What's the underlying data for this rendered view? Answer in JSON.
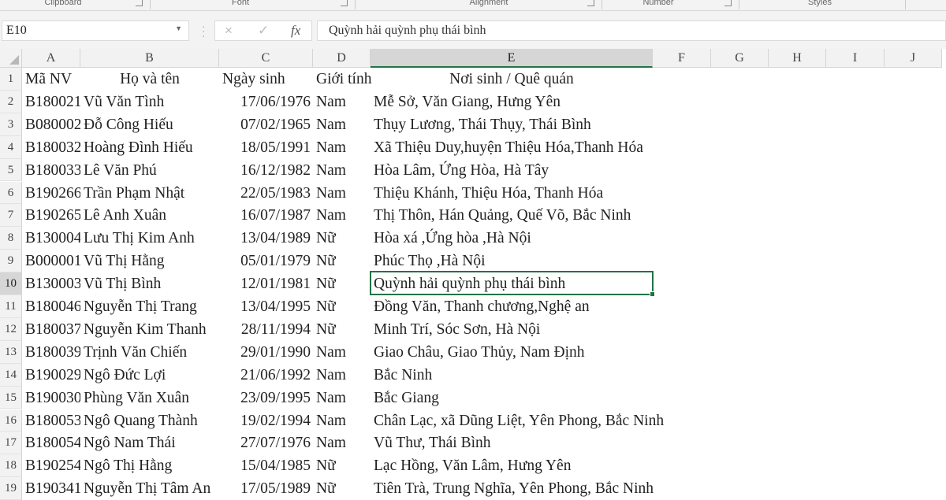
{
  "ribbon": {
    "groups": [
      "Clipboard",
      "Font",
      "Alignment",
      "Number",
      "Styles"
    ]
  },
  "formula_bar": {
    "name_box": "E10",
    "cancel_icon": "×",
    "enter_icon": "✓",
    "fx_label": "fx",
    "value": "Quỳnh hải quỳnh phụ thái bình"
  },
  "columns": [
    "A",
    "B",
    "C",
    "D",
    "E",
    "F",
    "G",
    "H",
    "I",
    "J"
  ],
  "selected_cell": "E10",
  "header_row": [
    "Mã NV",
    "Họ và tên",
    "Ngày sinh",
    "Giới tính",
    "Nơi sinh / Quê quán"
  ],
  "rows": [
    [
      "B180021",
      "Vũ Văn Tình",
      "17/06/1976",
      "Nam",
      "Mễ Sở, Văn Giang, Hưng Yên"
    ],
    [
      "B080002",
      "Đỗ Công Hiếu",
      "07/02/1965",
      "Nam",
      "Thụy Lương, Thái Thụy, Thái Bình"
    ],
    [
      "B180032",
      "Hoàng Đình Hiếu",
      "18/05/1991",
      "Nam",
      "Xã Thiệu Duy,huyện Thiệu Hóa,Thanh Hóa"
    ],
    [
      "B180033",
      "Lê Văn Phú",
      "16/12/1982",
      "Nam",
      "Hòa Lâm, Ứng Hòa, Hà Tây"
    ],
    [
      "B190266",
      "Trần Phạm Nhật",
      "22/05/1983",
      "Nam",
      "Thiệu Khánh, Thiệu Hóa, Thanh Hóa"
    ],
    [
      "B190265",
      "Lê Anh Xuân",
      "16/07/1987",
      "Nam",
      "Thị Thôn, Hán Quảng, Quế Võ, Bắc Ninh"
    ],
    [
      "B130004",
      "Lưu Thị Kim Anh",
      "13/04/1989",
      "Nữ",
      "Hòa xá ,Ứng hòa ,Hà Nội"
    ],
    [
      "B000001",
      "Vũ Thị Hằng",
      "05/01/1979",
      "Nữ",
      "Phúc Thọ ,Hà Nội"
    ],
    [
      "B130003",
      "Vũ Thị Bình",
      "12/01/1981",
      "Nữ",
      "Quỳnh hải quỳnh phụ thái bình"
    ],
    [
      "B180046",
      "Nguyễn Thị Trang",
      "13/04/1995",
      "Nữ",
      "Đồng Văn, Thanh chương,Nghệ an"
    ],
    [
      "B180037",
      "Nguyễn Kim Thanh",
      "28/11/1994",
      "Nữ",
      "Minh Trí, Sóc Sơn, Hà Nội"
    ],
    [
      "B180039",
      "Trịnh Văn Chiến",
      "29/01/1990",
      "Nam",
      "Giao Châu, Giao Thủy, Nam Định"
    ],
    [
      "B190029",
      "Ngô Đức Lợi",
      "21/06/1992",
      "Nam",
      "Bắc Ninh"
    ],
    [
      "B190030",
      "Phùng Văn Xuân",
      "23/09/1995",
      "Nam",
      "Bắc Giang"
    ],
    [
      "B180053",
      "Ngô Quang Thành",
      "19/02/1994",
      "Nam",
      "Chân Lạc, xã Dũng Liệt, Yên Phong, Bắc Ninh"
    ],
    [
      "B180054",
      "Ngô Nam Thái",
      "27/07/1976",
      "Nam",
      "Vũ Thư, Thái Bình"
    ],
    [
      "B190254",
      "Ngô Thị Hằng",
      "15/04/1985",
      "Nữ",
      "Lạc Hồng, Văn Lâm, Hưng Yên"
    ],
    [
      "B190341",
      "Nguyễn Thị Tâm An",
      "17/05/1989",
      "Nữ",
      "Tiên Trà, Trung Nghĩa, Yên Phong, Bắc Ninh"
    ]
  ]
}
